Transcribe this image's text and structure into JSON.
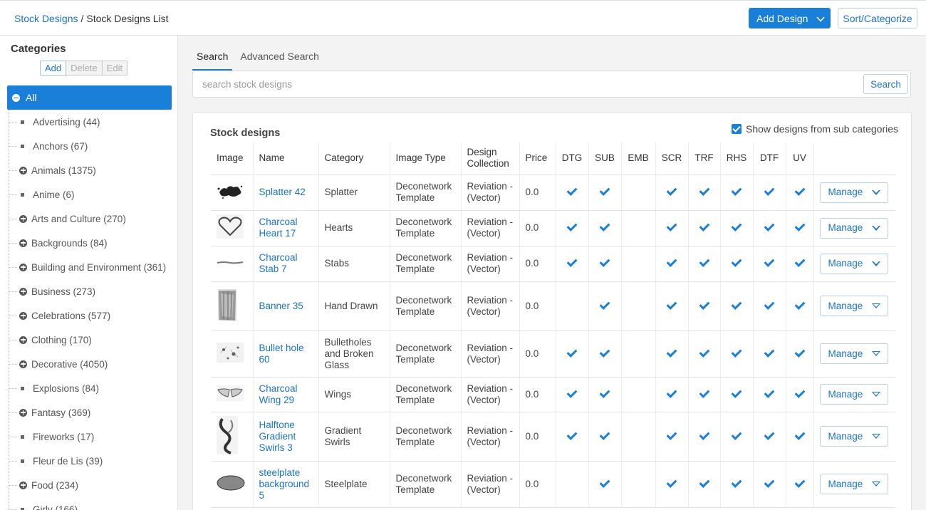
{
  "breadcrumb": {
    "root": "Stock Designs",
    "separator": "/",
    "current": "Stock Designs List"
  },
  "header": {
    "add_design_label": "Add Design",
    "sort_label": "Sort/Categorize"
  },
  "sidebar": {
    "title": "Categories",
    "actions": {
      "add": "Add",
      "delete": "Delete",
      "edit": "Edit"
    },
    "all_label": "All",
    "items": [
      {
        "label": "Advertising (44)",
        "expandable": false
      },
      {
        "label": "Anchors (67)",
        "expandable": false
      },
      {
        "label": "Animals (1375)",
        "expandable": true
      },
      {
        "label": "Anime (6)",
        "expandable": false
      },
      {
        "label": "Arts and Culture (270)",
        "expandable": true
      },
      {
        "label": "Backgrounds (84)",
        "expandable": true
      },
      {
        "label": "Building and Environment (361)",
        "expandable": true
      },
      {
        "label": "Business (273)",
        "expandable": true
      },
      {
        "label": "Celebrations (577)",
        "expandable": true
      },
      {
        "label": "Clothing (170)",
        "expandable": true
      },
      {
        "label": "Decorative (4050)",
        "expandable": true
      },
      {
        "label": "Explosions (84)",
        "expandable": false
      },
      {
        "label": "Fantasy (369)",
        "expandable": true
      },
      {
        "label": "Fireworks (17)",
        "expandable": false
      },
      {
        "label": "Fleur de Lis (39)",
        "expandable": false
      },
      {
        "label": "Food (234)",
        "expandable": true
      },
      {
        "label": "Girly (166)",
        "expandable": false
      }
    ]
  },
  "tabs": {
    "search": "Search",
    "advanced": "Advanced Search"
  },
  "search": {
    "placeholder": "search stock designs",
    "button": "Search"
  },
  "card": {
    "title": "Stock designs",
    "subcat_label": "Show designs from sub categories",
    "subcat_checked": true
  },
  "table": {
    "headers": {
      "image": "Image",
      "name": "Name",
      "category": "Category",
      "image_type": "Image Type",
      "collection": "Design Collection",
      "price": "Price",
      "dtg": "DTG",
      "sub": "SUB",
      "emb": "EMB",
      "scr": "SCR",
      "trf": "TRF",
      "rhs": "RHS",
      "dtf": "DTF",
      "uv": "UV"
    },
    "manage_label": "Manage",
    "rows": [
      {
        "thumb": "splatter-thumbnail",
        "name": "Splatter 42",
        "category": "Splatter",
        "image_type": "Deconetwork Template",
        "collection": "Reviation - (Vector)",
        "price": "0.0",
        "dtg": true,
        "sub": true,
        "emb": false,
        "scr": true,
        "trf": true,
        "rhs": true,
        "dtf": true,
        "uv": true
      },
      {
        "thumb": "heart-thumbnail",
        "name": "Charcoal Heart 17",
        "category": "Hearts",
        "image_type": "Deconetwork Template",
        "collection": "Reviation - (Vector)",
        "price": "0.0",
        "dtg": true,
        "sub": true,
        "emb": false,
        "scr": true,
        "trf": true,
        "rhs": true,
        "dtf": true,
        "uv": true
      },
      {
        "thumb": "stab-thumbnail",
        "name": "Charcoal Stab 7",
        "category": "Stabs",
        "image_type": "Deconetwork Template",
        "collection": "Reviation - (Vector)",
        "price": "0.0",
        "dtg": true,
        "sub": true,
        "emb": false,
        "scr": true,
        "trf": true,
        "rhs": true,
        "dtf": true,
        "uv": true
      },
      {
        "thumb": "banner-thumbnail",
        "name": "Banner 35",
        "category": "Hand Drawn",
        "image_type": "Deconetwork Template",
        "collection": "Reviation - (Vector)",
        "price": "0.0",
        "dtg": false,
        "sub": true,
        "emb": false,
        "scr": true,
        "trf": true,
        "rhs": true,
        "dtf": true,
        "uv": true
      },
      {
        "thumb": "bullet-hole-thumbnail",
        "name": "Bullet hole 60",
        "category": "Bulletholes and Broken Glass",
        "image_type": "Deconetwork Template",
        "collection": "Reviation - (Vector)",
        "price": "0.0",
        "dtg": true,
        "sub": true,
        "emb": false,
        "scr": true,
        "trf": true,
        "rhs": true,
        "dtf": true,
        "uv": true
      },
      {
        "thumb": "wing-thumbnail",
        "name": "Charcoal Wing 29",
        "category": "Wings",
        "image_type": "Deconetwork Template",
        "collection": "Reviation - (Vector)",
        "price": "0.0",
        "dtg": true,
        "sub": true,
        "emb": false,
        "scr": true,
        "trf": true,
        "rhs": true,
        "dtf": true,
        "uv": true
      },
      {
        "thumb": "swirl-thumbnail",
        "name": "Halftone Gradient Swirls 3",
        "category": "Gradient Swirls",
        "image_type": "Deconetwork Template",
        "collection": "Reviation - (Vector)",
        "price": "0.0",
        "dtg": true,
        "sub": true,
        "emb": false,
        "scr": true,
        "trf": true,
        "rhs": true,
        "dtf": true,
        "uv": true
      },
      {
        "thumb": "steelplate-thumbnail",
        "name": "steelplate background 5",
        "category": "Steelplate",
        "image_type": "Deconetwork Template",
        "collection": "Reviation - (Vector)",
        "price": "0.0",
        "dtg": false,
        "sub": true,
        "emb": false,
        "scr": true,
        "trf": true,
        "rhs": true,
        "dtf": true,
        "uv": true
      }
    ]
  },
  "colors": {
    "accent": "#1a7fd9",
    "link": "#1a73c8"
  }
}
